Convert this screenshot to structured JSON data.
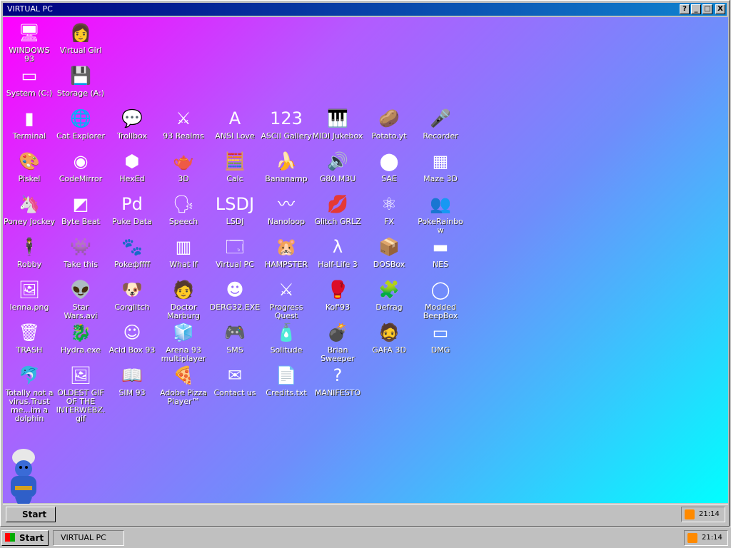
{
  "window": {
    "title": "VIRTUAL PC"
  },
  "titlebar_buttons": [
    "?",
    "_",
    "□",
    "X"
  ],
  "colors": {
    "gradient_start": "#ff00ff",
    "gradient_end": "#00ffff",
    "title_bar": "#000080"
  },
  "icons": [
    {
      "label": "WINDOWS 93",
      "icon": "computer-icon",
      "glyph": "🖥",
      "col": 0,
      "row": 0
    },
    {
      "label": "Virtual Girl",
      "icon": "girl-portrait-icon",
      "glyph": "👩",
      "col": 1,
      "row": 0
    },
    {
      "label": "System (C:)",
      "icon": "hard-drive-icon",
      "glyph": "▭",
      "col": 0,
      "row": 1
    },
    {
      "label": "Storage (A:)",
      "icon": "floppy-drive-icon",
      "glyph": "💾",
      "col": 1,
      "row": 1
    },
    {
      "label": "Terminal",
      "icon": "terminal-icon",
      "glyph": "▮",
      "col": 0,
      "row": 2
    },
    {
      "label": "Cat Explorer",
      "icon": "globe-icon",
      "glyph": "🌐",
      "col": 1,
      "row": 2
    },
    {
      "label": "Trollbox",
      "icon": "chat-icon",
      "glyph": "💬",
      "col": 2,
      "row": 2
    },
    {
      "label": "93 Realms",
      "icon": "warrior-icon",
      "glyph": "⚔",
      "col": 3,
      "row": 2
    },
    {
      "label": "ANSI Love",
      "icon": "ansi-letter-icon",
      "glyph": "A",
      "col": 4,
      "row": 2
    },
    {
      "label": "ASCII Gallery",
      "icon": "numbers-icon",
      "glyph": "123",
      "col": 5,
      "row": 2
    },
    {
      "label": "MIDI Jukebox",
      "icon": "piano-icon",
      "glyph": "🎹",
      "col": 6,
      "row": 2
    },
    {
      "label": "Potato.yt",
      "icon": "potato-icon",
      "glyph": "🥔",
      "col": 7,
      "row": 2
    },
    {
      "label": "Recorder",
      "icon": "microphone-icon",
      "glyph": "🎤",
      "col": 8,
      "row": 2
    },
    {
      "label": "Piskel",
      "icon": "palette-icon",
      "glyph": "🎨",
      "col": 0,
      "row": 3
    },
    {
      "label": "CodeMirror",
      "icon": "codemirror-icon",
      "glyph": "◉",
      "col": 1,
      "row": 3
    },
    {
      "label": "HexEd",
      "icon": "hexagon-icon",
      "glyph": "⬢",
      "col": 2,
      "row": 3
    },
    {
      "label": "3D",
      "icon": "teapot-icon",
      "glyph": "🫖",
      "col": 3,
      "row": 3
    },
    {
      "label": "Calc",
      "icon": "calculator-icon",
      "glyph": "🧮",
      "col": 4,
      "row": 3
    },
    {
      "label": "Bananamp",
      "icon": "banana-icon",
      "glyph": "🍌",
      "col": 5,
      "row": 3
    },
    {
      "label": "G80.M3U",
      "icon": "audio-file-icon",
      "glyph": "🔊",
      "col": 6,
      "row": 3
    },
    {
      "label": "SAE",
      "icon": "amiga-ball-icon",
      "glyph": "⬤",
      "col": 7,
      "row": 3
    },
    {
      "label": "Maze 3D",
      "icon": "maze-icon",
      "glyph": "▦",
      "col": 8,
      "row": 3
    },
    {
      "label": "Poney Jockey",
      "icon": "pony-icon",
      "glyph": "🦄",
      "col": 0,
      "row": 4
    },
    {
      "label": "Byte Beat",
      "icon": "byte-beat-icon",
      "glyph": "◩",
      "col": 1,
      "row": 4
    },
    {
      "label": "Puke Data",
      "icon": "pd-icon",
      "glyph": "Pd",
      "col": 2,
      "row": 4
    },
    {
      "label": "Speech",
      "icon": "face-speech-icon",
      "glyph": "🗣",
      "col": 3,
      "row": 4
    },
    {
      "label": "LSDJ",
      "icon": "lsdj-icon",
      "glyph": "LSDJ",
      "col": 4,
      "row": 4
    },
    {
      "label": "Nanoloop",
      "icon": "wave-icon",
      "glyph": "〰",
      "col": 5,
      "row": 4
    },
    {
      "label": "Glitch GRLZ",
      "icon": "lips-icon",
      "glyph": "💋",
      "col": 6,
      "row": 4
    },
    {
      "label": "FX",
      "icon": "atom-icon",
      "glyph": "⚛",
      "col": 7,
      "row": 4
    },
    {
      "label": "PokeRainbow",
      "icon": "pokemon-trainers-icon",
      "glyph": "👥",
      "col": 8,
      "row": 4
    },
    {
      "label": "Robby",
      "icon": "stick-figure-icon",
      "glyph": "🕴",
      "col": 0,
      "row": 5
    },
    {
      "label": "Take this",
      "icon": "pixel-character-icon",
      "glyph": "👾",
      "col": 1,
      "row": 5
    },
    {
      "label": "Pokeфffff",
      "icon": "pokemon-icon",
      "glyph": "🐾",
      "col": 2,
      "row": 5
    },
    {
      "label": "What If",
      "icon": "spreadsheet-icon",
      "glyph": "▥",
      "col": 3,
      "row": 5
    },
    {
      "label": "Virtual PC",
      "icon": "window-icon",
      "glyph": "🗔",
      "col": 4,
      "row": 5
    },
    {
      "label": "HAMPSTER",
      "icon": "hamster-icon",
      "glyph": "🐹",
      "col": 5,
      "row": 5
    },
    {
      "label": "Half-Life 3",
      "icon": "lambda-icon",
      "glyph": "λ",
      "col": 6,
      "row": 5
    },
    {
      "label": "DOSBox",
      "icon": "dosbox-icon",
      "glyph": "📦",
      "col": 7,
      "row": 5
    },
    {
      "label": "NES",
      "icon": "nes-console-icon",
      "glyph": "▬",
      "col": 8,
      "row": 5
    },
    {
      "label": "lenna.png",
      "icon": "image-file-icon",
      "glyph": "🖼",
      "col": 0,
      "row": 6
    },
    {
      "label": "Star Wars.avi",
      "icon": "yoda-icon",
      "glyph": "👽",
      "col": 1,
      "row": 6
    },
    {
      "label": "Corglitch",
      "icon": "corgi-icon",
      "glyph": "🐶",
      "col": 2,
      "row": 6
    },
    {
      "label": "Doctor Marburg",
      "icon": "doctor-icon",
      "glyph": "🧑",
      "col": 3,
      "row": 6
    },
    {
      "label": "DERG32.EXE",
      "icon": "face-monitor-icon",
      "glyph": "☻",
      "col": 4,
      "row": 6
    },
    {
      "label": "Progress Quest",
      "icon": "crossed-swords-icon",
      "glyph": "⚔",
      "col": 5,
      "row": 6
    },
    {
      "label": "Kof'93",
      "icon": "fighter-icon",
      "glyph": "🥊",
      "col": 6,
      "row": 6
    },
    {
      "label": "Defrag",
      "icon": "defrag-icon",
      "glyph": "🧩",
      "col": 7,
      "row": 6
    },
    {
      "label": "Modded BeepBox",
      "icon": "ring-icon",
      "glyph": "◯",
      "col": 8,
      "row": 6
    },
    {
      "label": "TRASH",
      "icon": "recycle-bin-icon",
      "glyph": "🗑",
      "col": 0,
      "row": 7
    },
    {
      "label": "Hydra.exe",
      "icon": "dragon-icon",
      "glyph": "🐉",
      "col": 1,
      "row": 7
    },
    {
      "label": "Acid Box 93",
      "icon": "smiley-icon",
      "glyph": "☺",
      "col": 2,
      "row": 7
    },
    {
      "label": "Arena 93 multiplayer",
      "icon": "cube-icon",
      "glyph": "🧊",
      "col": 3,
      "row": 7
    },
    {
      "label": "SMS",
      "icon": "game-console-icon",
      "glyph": "🎮",
      "col": 4,
      "row": 7
    },
    {
      "label": "Solitude",
      "icon": "bottle-icon",
      "glyph": "🧴",
      "col": 5,
      "row": 7
    },
    {
      "label": "Brian Sweeper",
      "icon": "mine-icon",
      "glyph": "💣",
      "col": 6,
      "row": 7
    },
    {
      "label": "GAFA 3D",
      "icon": "face-3d-icon",
      "glyph": "🧔",
      "col": 7,
      "row": 7
    },
    {
      "label": "DMG",
      "icon": "gameboy-icon",
      "glyph": "▭",
      "col": 8,
      "row": 7
    },
    {
      "label": "Totally not a virus.Trust me...im a dolphin",
      "icon": "dolphin-icon",
      "glyph": "🐬",
      "col": 0,
      "row": 8
    },
    {
      "label": "OLDEST GIF OF THE INTERWEBZ.gif",
      "icon": "gif-file-icon",
      "glyph": "🖼",
      "col": 1,
      "row": 8
    },
    {
      "label": "SIM 93",
      "icon": "book-icon",
      "glyph": "📖",
      "col": 2,
      "row": 8
    },
    {
      "label": "Adobe Pizza Player™",
      "icon": "pizza-icon",
      "glyph": "🍕",
      "col": 3,
      "row": 8
    },
    {
      "label": "Contact us",
      "icon": "contact-icon",
      "glyph": "✉",
      "col": 4,
      "row": 8
    },
    {
      "label": "Credits.txt",
      "icon": "text-file-icon",
      "glyph": "📄",
      "col": 5,
      "row": 8
    },
    {
      "label": "MANIFESTO",
      "icon": "question-mark-icon",
      "glyph": "?",
      "col": 6,
      "row": 8
    }
  ],
  "inner_taskbar": {
    "start_label": "Start",
    "clock": "21:14"
  },
  "outer_taskbar": {
    "start_label": "Start",
    "task_label": "VIRTUAL PC",
    "clock": "21:14"
  }
}
